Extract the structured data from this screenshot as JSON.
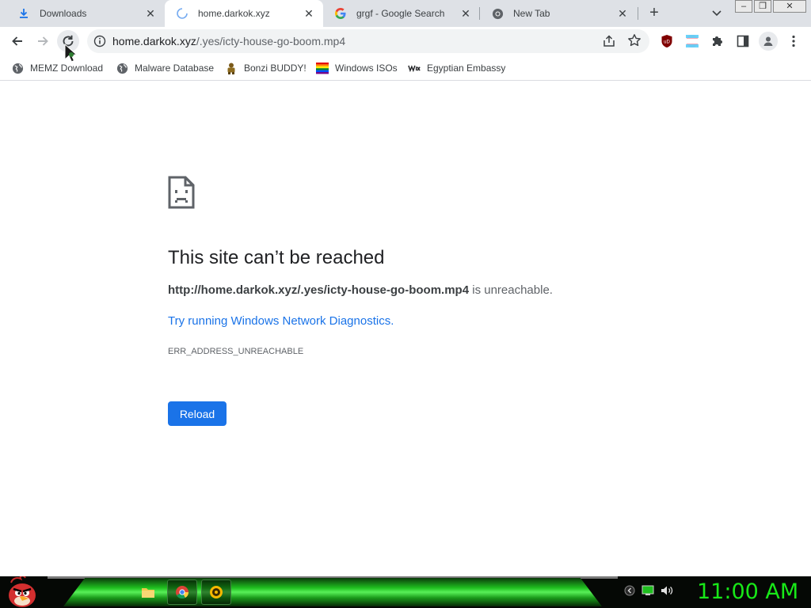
{
  "tabs": [
    {
      "title": "Downloads",
      "icon": "download-icon",
      "active": false
    },
    {
      "title": "home.darkok.xyz",
      "icon": "loading-spinner-icon",
      "active": true
    },
    {
      "title": "grgf - Google Search",
      "icon": "google-icon",
      "active": false
    },
    {
      "title": "New Tab",
      "icon": "chrome-icon",
      "active": false
    }
  ],
  "tab_close_glyph": "✕",
  "new_tab_glyph": "+",
  "window_controls": {
    "minimize": "–",
    "restore": "❐",
    "close": "✕"
  },
  "omnibox": {
    "host": "home.darkok.xyz",
    "path": "/.yes/icty-house-go-boom.mp4"
  },
  "bookmarks": [
    {
      "label": "MEMZ Download",
      "icon": "globe-icon"
    },
    {
      "label": "Malware Database",
      "icon": "globe-icon"
    },
    {
      "label": "Bonzi BUDDY!",
      "icon": "bonzi-icon"
    },
    {
      "label": "Windows ISOs",
      "icon": "rainbow-flag-icon"
    },
    {
      "label": "Egyptian Embassy",
      "icon": "wix-icon"
    }
  ],
  "extensions": [
    "ublock-icon",
    "flag-extension-icon",
    "puzzle-icon",
    "side-panel-icon",
    "profile-icon",
    "kebab-menu-icon"
  ],
  "error": {
    "title": "This site can’t be reached",
    "url": "http://home.darkok.xyz/.yes/icty-house-go-boom.mp4",
    "suffix": " is unreachable.",
    "link": "Try running Windows Network Diagnostics.",
    "code": "ERR_ADDRESS_UNREACHABLE",
    "reload_label": "Reload"
  },
  "taskbar": {
    "items": [
      "file-explorer-icon",
      "chrome-icon",
      "media-player-icon"
    ],
    "clock": "11:00 AM"
  },
  "colors": {
    "accent_blue": "#1a73e8",
    "clock_green": "#18e818",
    "tab_strip": "#dee1e6"
  }
}
